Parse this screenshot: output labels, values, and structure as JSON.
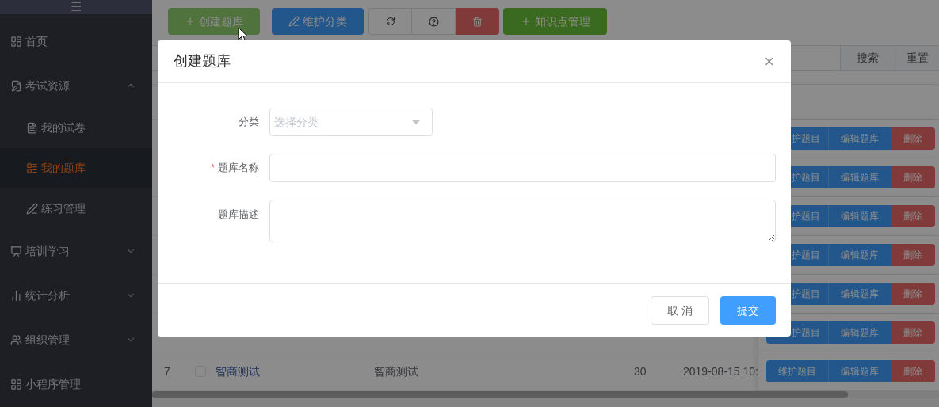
{
  "sidebar": {
    "menu_icon": "☰",
    "items": [
      {
        "label": "首页",
        "selected": false
      },
      {
        "label": "考试资源",
        "selected": false,
        "expanded": true,
        "children": [
          {
            "label": "我的试卷",
            "selected": false
          },
          {
            "label": "我的题库",
            "selected": true
          },
          {
            "label": "练习管理",
            "selected": false
          }
        ]
      },
      {
        "label": "培训学习",
        "selected": false,
        "expanded": false
      },
      {
        "label": "统计分析",
        "selected": false,
        "expanded": false
      },
      {
        "label": "组织管理",
        "selected": false,
        "expanded": false
      },
      {
        "label": "小程序管理",
        "selected": false
      }
    ]
  },
  "toolbar": [
    {
      "kind": "create",
      "label": "创建题库"
    },
    {
      "kind": "edit",
      "label": "维护分类"
    },
    {
      "kind": "refresh"
    },
    {
      "kind": "help"
    },
    {
      "kind": "delete"
    },
    {
      "kind": "add",
      "label": "知识点管理"
    }
  ],
  "search_buttons": [
    "搜索",
    "重置"
  ],
  "table": {
    "rows": [
      {
        "actions": [
          "护题目",
          "编辑题库",
          "删除"
        ]
      },
      {
        "actions": [
          "护题目",
          "编辑题库",
          "删除"
        ]
      },
      {
        "actions": [
          "护题目",
          "编辑题库",
          "删除"
        ]
      },
      {
        "actions": [
          "护题目",
          "编辑题库",
          "删除"
        ]
      },
      {
        "actions": [
          "护题目",
          "编辑题库",
          "删除"
        ]
      },
      {
        "actions": [
          "护题目",
          "编辑题库",
          "删除"
        ]
      },
      {
        "index": "7",
        "checked": false,
        "name": "智商测试",
        "description": "智商测试",
        "count": "30",
        "created": "2019-08-15 10:",
        "actions": [
          "维护题目",
          "编辑题库",
          "删除"
        ]
      }
    ]
  },
  "dialog": {
    "title": "创建题库",
    "close": "×",
    "fields": [
      {
        "kind": "select",
        "label": "分类",
        "placeholder": "选择分类"
      },
      {
        "kind": "input",
        "label": "题库名称",
        "required_mark": "*"
      },
      {
        "kind": "textarea",
        "label": "题库描述"
      }
    ],
    "buttons": [
      {
        "kind": "cancel",
        "label": "取 消"
      },
      {
        "kind": "submit",
        "label": "提交"
      }
    ]
  }
}
